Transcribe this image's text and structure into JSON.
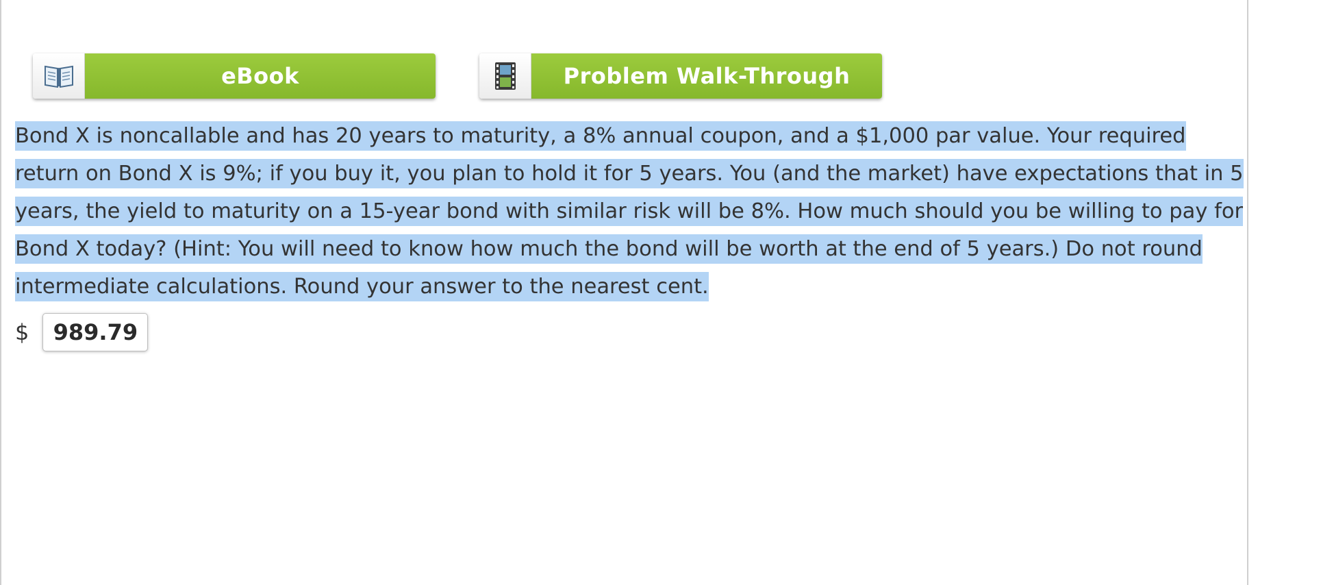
{
  "toolbar": {
    "ebook_label": "eBook",
    "walkthrough_label": "Problem Walk-Through",
    "ebook_icon": "open-book-icon",
    "walkthrough_icon": "film-strip-icon"
  },
  "problem": {
    "text": "Bond X is noncallable and has 20 years to maturity, a 8% annual coupon, and a $1,000 par value. Your required return on Bond X is 9%; if you buy it, you plan to hold it for 5 years. You (and the market) have expectations that in 5 years, the yield to maturity on a 15-year bond with similar risk will be 8%. How much should you be willing to pay for Bond X today? (Hint: You will need to know how much the bond will be worth at the end of 5 years.) Do not round intermediate calculations. Round your answer to the nearest cent."
  },
  "answer": {
    "currency_symbol": "$",
    "value": "989.79"
  },
  "colors": {
    "button_green": "#8fc134",
    "selection_blue": "#b3d4f5"
  }
}
